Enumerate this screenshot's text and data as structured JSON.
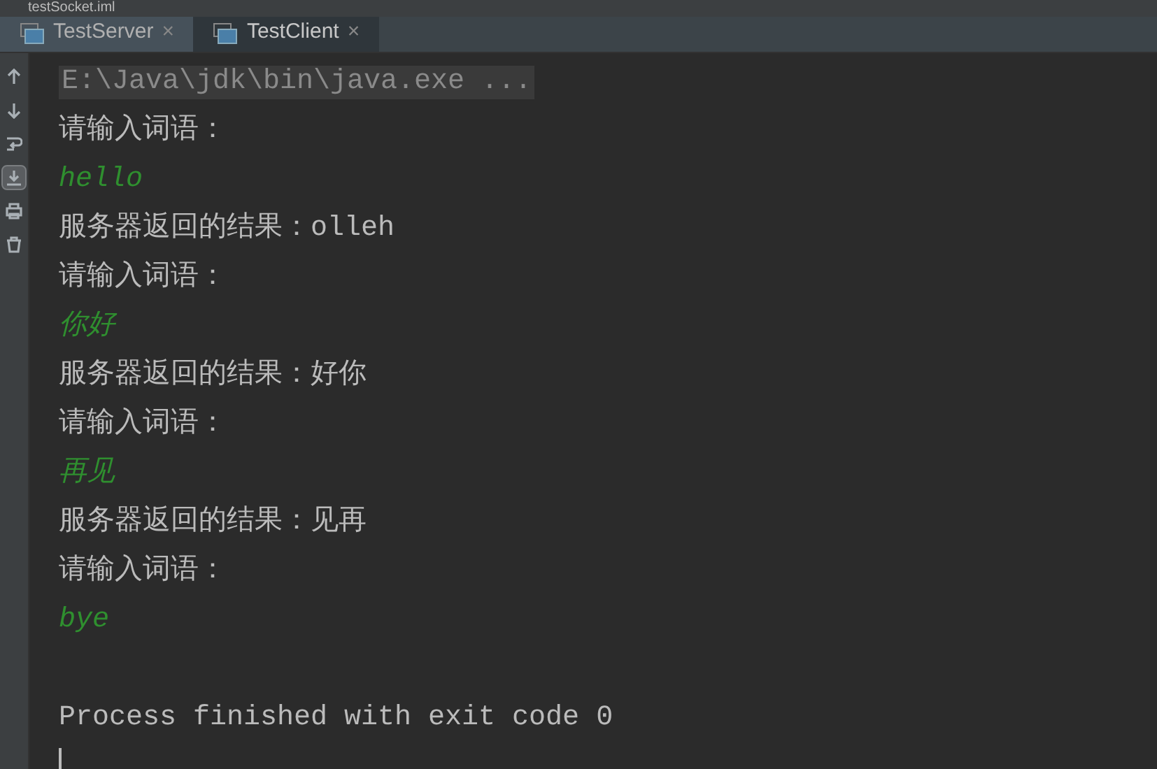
{
  "file_strip": {
    "label": "testSocket.iml"
  },
  "tabs": [
    {
      "label": "TestServer",
      "selected": false,
      "close": "×"
    },
    {
      "label": "TestClient",
      "selected": true,
      "close": "×"
    }
  ],
  "console": {
    "lines": [
      {
        "kind": "command",
        "text": "E:\\Java\\jdk\\bin\\java.exe ..."
      },
      {
        "kind": "output",
        "text": "请输入词语："
      },
      {
        "kind": "input",
        "text": "hello"
      },
      {
        "kind": "output",
        "text": "服务器返回的结果：olleh"
      },
      {
        "kind": "output",
        "text": "请输入词语："
      },
      {
        "kind": "input",
        "text": "你好"
      },
      {
        "kind": "output",
        "text": "服务器返回的结果：好你"
      },
      {
        "kind": "output",
        "text": "请输入词语："
      },
      {
        "kind": "input",
        "text": "再见"
      },
      {
        "kind": "output",
        "text": "服务器返回的结果：见再"
      },
      {
        "kind": "output",
        "text": "请输入词语："
      },
      {
        "kind": "input",
        "text": "bye"
      },
      {
        "kind": "blank"
      },
      {
        "kind": "output",
        "text": "Process finished with exit code 0"
      },
      {
        "kind": "cursor"
      }
    ]
  }
}
